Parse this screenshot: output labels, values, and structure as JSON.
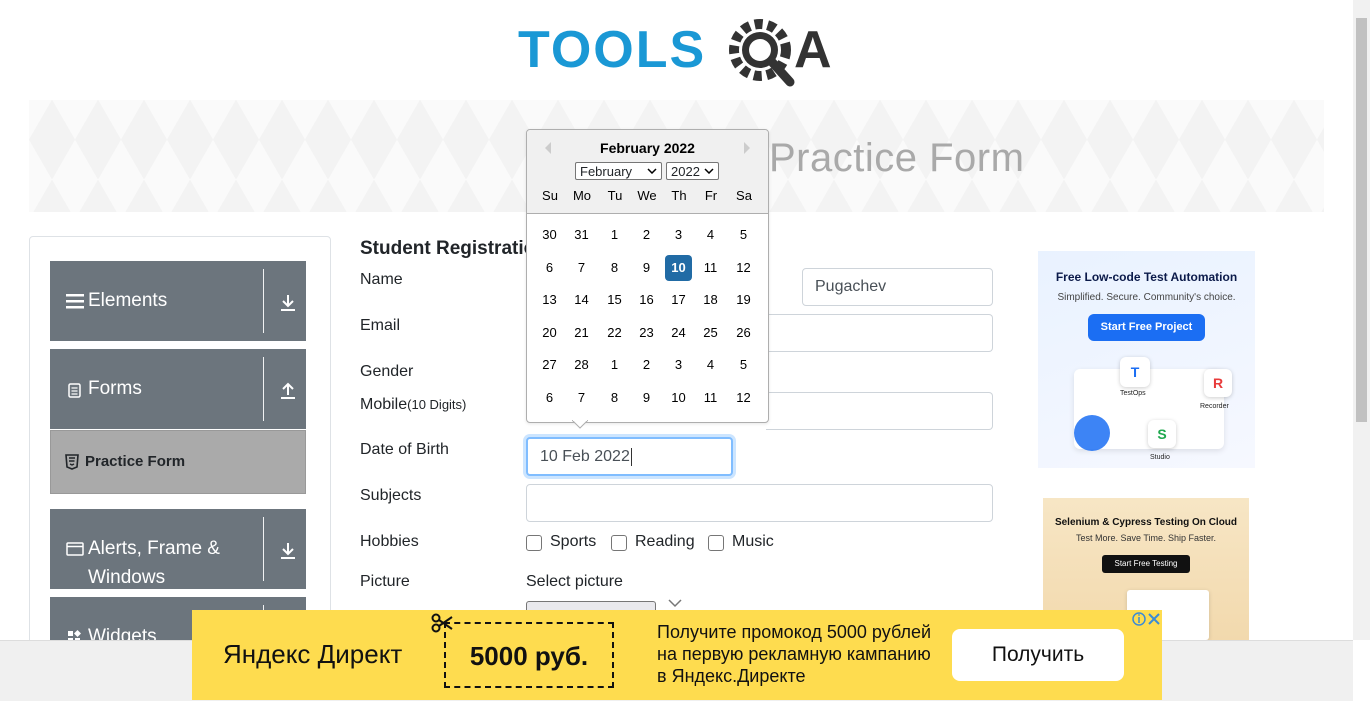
{
  "logo": {
    "brand": "TOOLSQA",
    "text": "TOOLS",
    "suffix": "A"
  },
  "banner": {
    "title": "Practice Form"
  },
  "sidebar": {
    "groups": [
      {
        "label": "Elements",
        "icon": "hamburger-icon",
        "arrow": "download-icon"
      },
      {
        "label": "Forms",
        "icon": "document-icon",
        "arrow": "upload-icon"
      },
      {
        "label": "Alerts, Frame & Windows",
        "icon": "window-icon",
        "arrow": "download-icon"
      },
      {
        "label": "Widgets",
        "icon": "widgets-icon",
        "arrow": "download-icon"
      }
    ],
    "active_item": {
      "label": "Practice Form",
      "icon": "html5-icon"
    }
  },
  "form": {
    "heading": "Student Registration Form",
    "name_label": "Name",
    "last_name_value": "Pugachev",
    "email_label": "Email",
    "gender_label": "Gender",
    "mobile_label": "Mobile",
    "mobile_hint": "(10 Digits)",
    "dob_label": "Date of Birth",
    "dob_value": "10 Feb 2022",
    "subjects_label": "Subjects",
    "hobbies_label": "Hobbies",
    "hobbies": [
      "Sports",
      "Reading",
      "Music"
    ],
    "picture_label": "Picture",
    "picture_select": "Select picture"
  },
  "calendar": {
    "title": "February 2022",
    "month_select": "February",
    "year_select": "2022",
    "day_names": [
      "Su",
      "Mo",
      "Tu",
      "We",
      "Th",
      "Fr",
      "Sa"
    ],
    "weeks": [
      [
        "30",
        "31",
        "1",
        "2",
        "3",
        "4",
        "5"
      ],
      [
        "6",
        "7",
        "8",
        "9",
        "10",
        "11",
        "12"
      ],
      [
        "13",
        "14",
        "15",
        "16",
        "17",
        "18",
        "19"
      ],
      [
        "20",
        "21",
        "22",
        "23",
        "24",
        "25",
        "26"
      ],
      [
        "27",
        "28",
        "1",
        "2",
        "3",
        "4",
        "5"
      ],
      [
        "6",
        "7",
        "8",
        "9",
        "10",
        "11",
        "12"
      ]
    ],
    "selected": "10",
    "accent": "#216ba5"
  },
  "ads": {
    "ad1": {
      "title": "Free Low-code Test Automation",
      "subtitle": "Simplified. Secure. Community's choice.",
      "button": "Start Free Project",
      "labels": [
        "TestOps",
        "Recorder",
        "Studio"
      ]
    },
    "ad2": {
      "title": "Selenium & Cypress Testing On Cloud",
      "subtitle": "Test More. Save Time. Ship Faster.",
      "button": "Start Free Testing"
    }
  },
  "yandex": {
    "brand": "Яндекс Директ",
    "promo": "5000 руб.",
    "text": "Получите промокод 5000 рублей на первую рекламную кампанию в Яндекс.Директе",
    "button": "Получить"
  },
  "colors": {
    "sidebar_bg": "#6c757d",
    "active_bg": "#aaaaaa",
    "brand_blue": "#1a98d5",
    "yandex_yellow": "#fedc4f"
  }
}
